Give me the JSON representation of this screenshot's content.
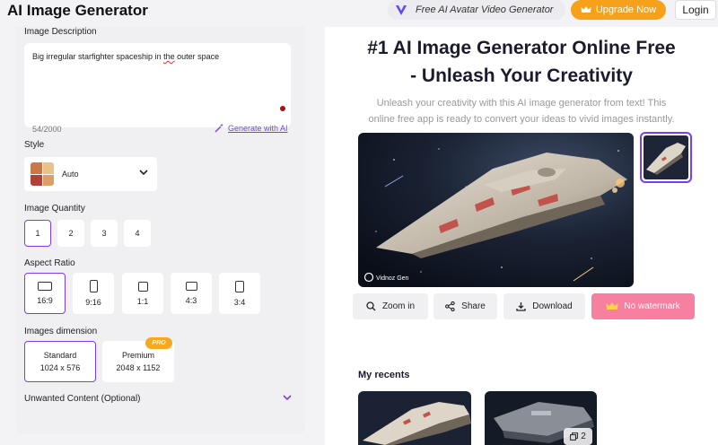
{
  "header": {
    "brand": "AI Image Generator",
    "avatar_link": "Free AI Avatar Video Generator",
    "upgrade_label": "Upgrade Now",
    "login_label": "Login"
  },
  "form": {
    "description_label": "Image Description",
    "description_value_prefix": "Big irregular starfighter spaceship in ",
    "description_value_underlined": "the",
    "description_value_suffix": " outer space",
    "char_count": "54/2000",
    "generate_with_ai": "Generate with AI",
    "style_label": "Style",
    "style_value": "Auto",
    "quantity_label": "Image Quantity",
    "quantities": [
      "1",
      "2",
      "3",
      "4"
    ],
    "aspect_label": "Aspect Ratio",
    "aspect_ratios": [
      "16:9",
      "9:16",
      "1:1",
      "4:3",
      "3:4"
    ],
    "dimension_label": "Images dimension",
    "dimensions": [
      {
        "name": "Standard",
        "size": "1024 x 576"
      },
      {
        "name": "Premium",
        "size": "2048 x 1152"
      }
    ],
    "pro_badge": "PRO",
    "unwanted_label": "Unwanted Content (Optional)"
  },
  "preview": {
    "headline_line1": "#1 AI Image Generator Online Free",
    "headline_line2": "- Unleash Your Creativity",
    "subtext_line1": "Unleash your creativity with this AI image generator from text! This",
    "subtext_line2": "online free app is ready to convert your ideas to vivid images instantly.",
    "watermark_text": "Vidnoz Gen",
    "actions": {
      "zoom": "Zoom in",
      "share": "Share",
      "download": "Download",
      "no_watermark": "No watermark"
    },
    "recents_title": "My recents",
    "recent_count": "2"
  },
  "colors": {
    "accent": "#7a3ef0",
    "upgrade": "#f7a11a",
    "no_watermark": "#f77fa0"
  }
}
